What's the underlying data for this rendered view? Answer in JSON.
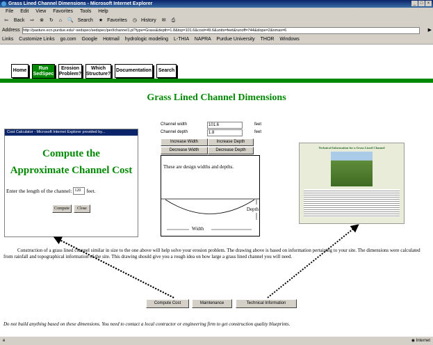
{
  "browser": {
    "title": "Grass Lined Channel Dimensions - Microsoft Internet Explorer",
    "menu": [
      "File",
      "Edit",
      "View",
      "Favorites",
      "Tools",
      "Help"
    ],
    "toolbar": [
      "Back",
      "Search",
      "Favorites",
      "History"
    ],
    "address_label": "Address",
    "address": "http://pasture.ecn.purdue.edu/~sedspec/sedspec/perl/channel1.pl?type=Grass&depth=1.8&top=101.6&cost=49.6&units=feet&runoff=744&slope=2&nmax=6",
    "links_label": "Links",
    "links": [
      "Customize Links",
      "go.com",
      "Google",
      "Hotmail",
      "hydrologic modeling",
      "L-THIA",
      "NAPRA",
      "Purdue University",
      "THOR",
      "Windows"
    ],
    "status_zone": "Internet"
  },
  "nav": [
    {
      "label": "Home"
    },
    {
      "label": "Run SedSpec"
    },
    {
      "label": "Erosion Problem?"
    },
    {
      "label": "Which Structure?"
    },
    {
      "label": "Documentation"
    },
    {
      "label": "Search"
    }
  ],
  "page_title": "Grass Lined Channel Dimensions",
  "popup": {
    "title": "Cost Calculator - Microsoft Internet Explorer provided by...",
    "heading1": "Compute the",
    "heading2": "Approximate Channel Cost",
    "prompt": "Enter the length of the channel:",
    "length_value": "120",
    "unit": "feet.",
    "compute": "Compute",
    "close": "Close"
  },
  "form": {
    "width_label": "Channel width",
    "width_value": "101.6",
    "width_unit": "feet",
    "depth_label": "Channel depth",
    "depth_value": "1.8",
    "depth_unit": "feet",
    "inc_width": "Increase Width",
    "inc_depth": "Increase Depth",
    "dec_width": "Decrease Width",
    "dec_depth": "Decrease Depth"
  },
  "drawing": {
    "caption": "These are design widths and depths.",
    "depth": "Depth",
    "width": "Width"
  },
  "tech_image": {
    "title": "Technical Information for a Grass Lined Channel"
  },
  "body_text": "Construction of a grass lined channel similar in size to the one above will help solve your erosion problem. The drawing above is based on information pertaining to your site. The dimensions were calculated from rainfall and topographical information of the site. This drawing should give you a rough idea on how large a grass lined channel you will need.",
  "buttons": {
    "compute_cost": "Compute Cost",
    "maintenance": "Maintenance",
    "technical": "Technical Information"
  },
  "disclaimer": "Do not build anything based on these dimensions. You need to contact a local contractor or engineering firm to get construction quality blueprints."
}
